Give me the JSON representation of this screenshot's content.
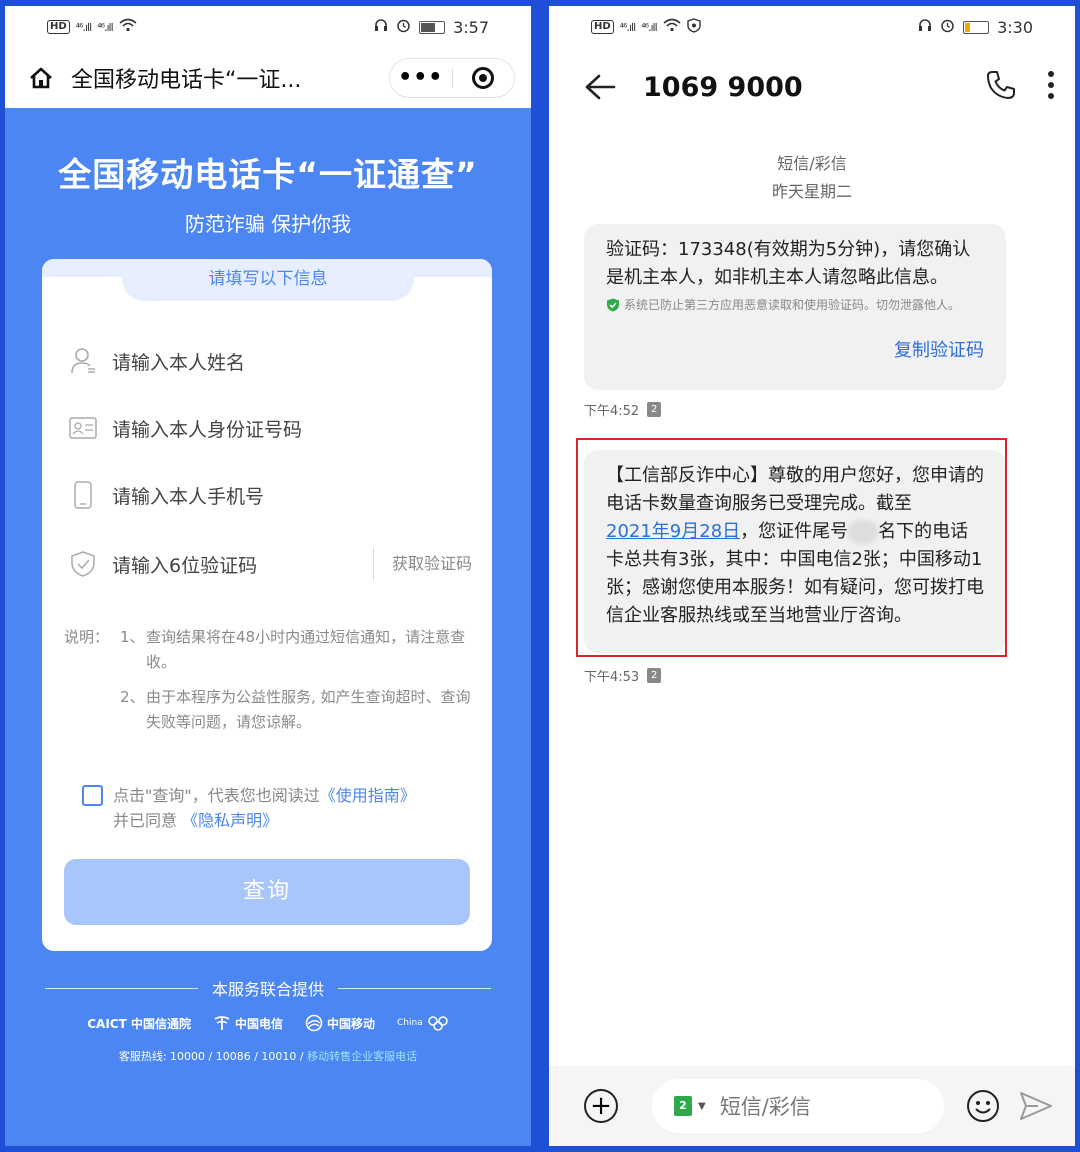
{
  "left": {
    "status": {
      "time": "3:57",
      "hd": "HD",
      "sig1": "⁴⁶.ıll",
      "sig2": "⁴⁶.ıll"
    },
    "title_bar": {
      "title": "全国移动电话卡“一证..."
    },
    "hero": {
      "title": "全国移动电话卡“一证通查”",
      "subtitle": "防范诈骗 保护你我"
    },
    "form": {
      "tab": "请填写以下信息",
      "name_placeholder": "请输入本人姓名",
      "id_placeholder": "请输入本人身份证号码",
      "phone_placeholder": "请输入本人手机号",
      "code_placeholder": "请输入6位验证码",
      "get_code": "获取验证码",
      "notes_label": "说明：",
      "note1_num": "1、",
      "note1": "查询结果将在48小时内通过短信通知，请注意查收。",
      "note2_num": "2、",
      "note2": "由于本程序为公益性服务, 如产生查询超时、查询失败等问题，请您谅解。",
      "agree_pre": "点击\"查询\"，代表您也阅读过",
      "guide_link": "《使用指南》",
      "agree_mid": "并已同意",
      "privacy_link": "《隐私声明》",
      "query_button": "查询"
    },
    "footer": {
      "provided": "本服务联合提供",
      "logo1": "CAICT 中国信通院",
      "logo2": "中国电信",
      "logo3": "中国移动",
      "logo4": "China",
      "hotline_pre": "客服热线: 10000 / 10086 / 10010 /",
      "hotline_link": "移动转售企业客服电话"
    }
  },
  "right": {
    "status": {
      "time": "3:30",
      "hd": "HD",
      "sig1": "⁴⁶.ıll",
      "sig2": "⁴⁶.ıll"
    },
    "header": {
      "number": "1069 9000"
    },
    "meta": {
      "type": "短信/彩信",
      "date": "昨天星期二"
    },
    "msg1": {
      "text": "验证码：173348(有效期为5分钟)，请您确认是机主本人，如非机主本人请忽略此信息。",
      "security_note": "系统已防止第三方应用恶意读取和使用验证码。切勿泄露他人。",
      "copy": "复制验证码",
      "time": "下午4:52",
      "sim": "2"
    },
    "msg2": {
      "part1": "【工信部反诈中心】尊敬的用户您好，您申请的电话卡数量查询服务已受理完成。截至",
      "date_link": "2021年9月28日",
      "part2": "，您证件尾号",
      "part3": "名下的电话卡总共有3张，其中：中国电信2张；中国移动1张；感谢您使用本服务！如有疑问，您可拨打电信企业客服热线或至当地营业厅咨询。",
      "time": "下午4:53",
      "sim": "2"
    },
    "input": {
      "placeholder": "短信/彩信",
      "sim": "2"
    }
  }
}
